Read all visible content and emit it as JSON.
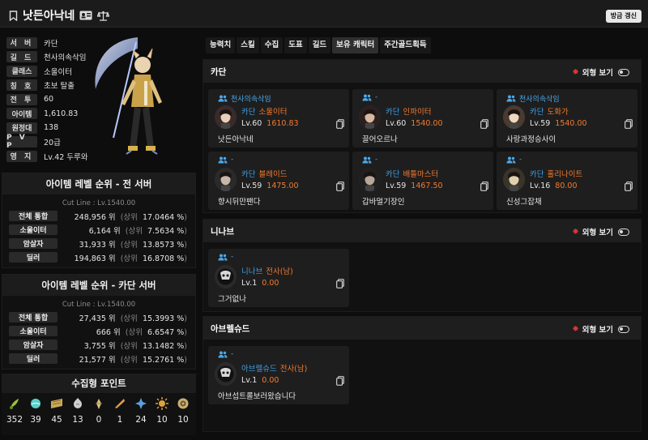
{
  "header": {
    "name": "낫든아낙네",
    "refresh_label": "방금 갱신"
  },
  "profile": {
    "rows": [
      {
        "label": "서 버",
        "value": "카단"
      },
      {
        "label": "길 드",
        "value": "천사의속삭임"
      },
      {
        "label": "클래스",
        "value": "소울이터"
      },
      {
        "label": "칭 호",
        "value": "초보 탈출"
      },
      {
        "label": "전 투",
        "value": "60"
      },
      {
        "label": "아이템",
        "value": "1,610.83"
      },
      {
        "label": "원정대",
        "value": "138"
      },
      {
        "label": "P V P",
        "value": "20급"
      },
      {
        "label": "영 지",
        "value": "Lv.42 두루와"
      }
    ]
  },
  "rank_all": {
    "title": "아이템 레벨 순위 - 전 서버",
    "cutline": "Cut Line : Lv.1540.00",
    "rows": [
      {
        "label": "전체 통합",
        "rank": "248,956 위",
        "pct": "17.0464 %"
      },
      {
        "label": "소울이터",
        "rank": "6,164 위",
        "pct": "7.5634 %"
      },
      {
        "label": "암살자",
        "rank": "31,933 위",
        "pct": "13.8573 %"
      },
      {
        "label": "딜러",
        "rank": "194,863 위",
        "pct": "16.8708 %"
      }
    ]
  },
  "rank_server": {
    "title": "아이템 레벨 순위 - 카단 서버",
    "cutline": "Cut Line : Lv.1540.00",
    "rows": [
      {
        "label": "전체 통합",
        "rank": "27,435 위",
        "pct": "15.3993 %"
      },
      {
        "label": "소울이터",
        "rank": "666 위",
        "pct": "6.6547 %"
      },
      {
        "label": "암살자",
        "rank": "3,755 위",
        "pct": "13.1482 %"
      },
      {
        "label": "딜러",
        "rank": "21,577 위",
        "pct": "15.2761 %"
      }
    ]
  },
  "rank_labels": {
    "open": "(상위",
    "close": ")"
  },
  "collect": {
    "title": "수집형 포인트",
    "items": [
      {
        "icon": "mokoko-seed-icon",
        "value": "352",
        "color": "#9ac13a"
      },
      {
        "icon": "island-heart-icon",
        "value": "39",
        "color": "#5ad0c8"
      },
      {
        "icon": "great-art-icon",
        "value": "45",
        "color": "#c9a85a"
      },
      {
        "icon": "giant-heart-icon",
        "value": "13",
        "color": "#cfcfcf"
      },
      {
        "icon": "ignea-token-icon",
        "value": "0",
        "color": "#d8c080"
      },
      {
        "icon": "voyage-token-icon",
        "value": "1",
        "color": "#d8a050"
      },
      {
        "icon": "world-tree-leaf-icon",
        "value": "24",
        "color": "#5aa0e0"
      },
      {
        "icon": "orpheus-star-icon",
        "value": "10",
        "color": "#e0a040"
      },
      {
        "icon": "omnium-star-icon",
        "value": "10",
        "color": "#c8b070"
      }
    ]
  },
  "tabs": [
    "능력치",
    "스킬",
    "수집",
    "도표",
    "길드",
    "보유 캐릭터",
    "주간골드획득"
  ],
  "active_tab": 5,
  "view_label": "외형 보기",
  "sections": [
    {
      "name": "카단",
      "cards": [
        {
          "guild": "천사의속삭임",
          "server": "카단",
          "cls": "소울이터",
          "lv": "Lv.60",
          "il": "1610.83",
          "name": "낫든아낙네"
        },
        {
          "guild": "-",
          "server": "카단",
          "cls": "인파이터",
          "lv": "Lv.60",
          "il": "1540.00",
          "name": "끌어오르나"
        },
        {
          "guild": "천사의속삭임",
          "server": "카단",
          "cls": "도화가",
          "lv": "Lv.59",
          "il": "1540.00",
          "name": "사랑과정승사이"
        },
        {
          "guild": "-",
          "server": "카단",
          "cls": "블레이드",
          "lv": "Lv.59",
          "il": "1475.00",
          "name": "향시뒤만팬다"
        },
        {
          "guild": "-",
          "server": "카단",
          "cls": "배틀마스터",
          "lv": "Lv.59",
          "il": "1467.50",
          "name": "갑바멀기장인"
        },
        {
          "guild": "-",
          "server": "카단",
          "cls": "홀리나이트",
          "lv": "Lv.16",
          "il": "80.00",
          "name": "신성그잡채"
        }
      ]
    },
    {
      "name": "니나브",
      "cards": [
        {
          "guild": "-",
          "server": "니나브",
          "cls": "전사(남)",
          "lv": "Lv.1",
          "il": "0.00",
          "name": "그거없나"
        }
      ]
    },
    {
      "name": "아브렐슈드",
      "cards": [
        {
          "guild": "-",
          "server": "아브렐슈드",
          "cls": "전사(남)",
          "lv": "Lv.1",
          "il": "0.00",
          "name": "아브섭트롤보러왔습니다"
        }
      ]
    }
  ],
  "colors": {
    "server": "#3f9fe6",
    "class": "#f47a2e",
    "guild": "#4aa8e8",
    "star": "#e23434"
  }
}
